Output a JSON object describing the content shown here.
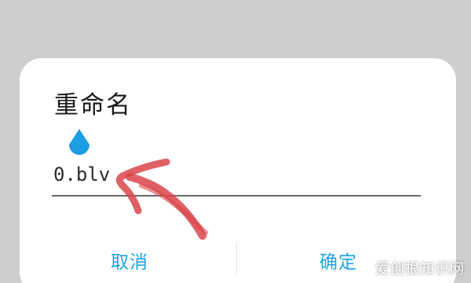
{
  "dialog": {
    "title": "重命名",
    "input_value": "0.blv",
    "cancel_label": "取消",
    "confirm_label": "确定"
  },
  "watermark": "爱创根知识网",
  "colors": {
    "accent": "#1fa3e0",
    "annotation": "#d9454b",
    "backdrop": "#cecece"
  }
}
